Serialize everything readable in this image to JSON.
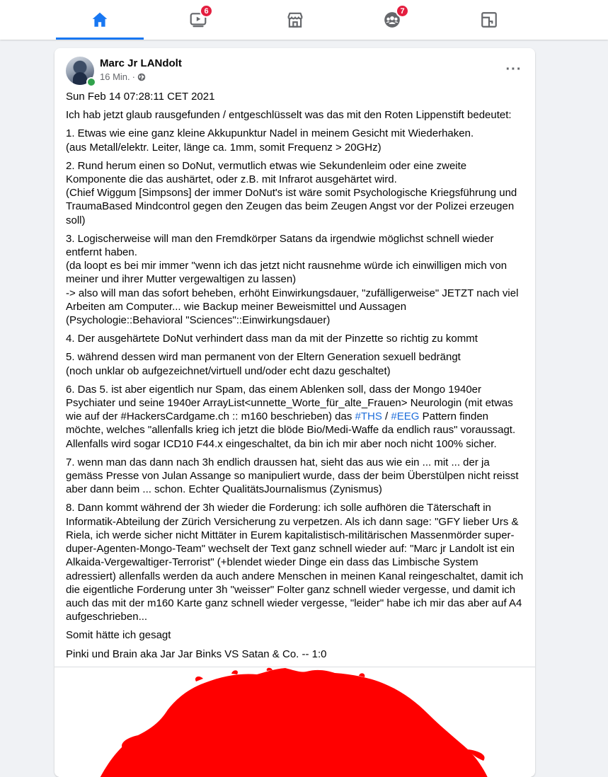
{
  "nav": {
    "tabs": [
      {
        "name": "home",
        "icon": "home-icon",
        "badge": ""
      },
      {
        "name": "watch",
        "icon": "video-icon",
        "badge": "6"
      },
      {
        "name": "marketplace",
        "icon": "store-icon",
        "badge": ""
      },
      {
        "name": "groups",
        "icon": "groups-icon",
        "badge": "7"
      },
      {
        "name": "gaming",
        "icon": "gaming-icon",
        "badge": ""
      }
    ],
    "accent": "#1877f2",
    "badge_color": "#e41e3f"
  },
  "post": {
    "author": "Marc Jr LANdolt",
    "time": "16 Min.",
    "separator": " · ",
    "privacy_icon": "globe-icon",
    "more_icon": "more-options-icon",
    "more_label": "···",
    "paragraphs": [
      "Sun Feb 14 07:28:11 CET 2021",
      "Ich hab jetzt glaub rausgefunden / entgeschlüsselt was das mit den Roten Lippenstift bedeutet:",
      "1. Etwas wie eine ganz kleine Akkupunktur Nadel in meinem Gesicht mit Wiederhaken.\n(aus Metall/elektr. Leiter, länge ca. 1mm, somit Frequenz > 20GHz)",
      "2. Rund herum einen so DoNut, vermutlich etwas wie Sekundenleim oder eine zweite Komponente die das aushärtet, oder z.B. mit Infrarot ausgehärtet wird.\n(Chief Wiggum [Simpsons] der immer DoNut's ist wäre somit Psychologische Kriegsführung und TraumaBased Mindcontrol gegen den Zeugen das beim Zeugen Angst vor der Polizei erzeugen soll)",
      "3. Logischerweise will man den Fremdkörper Satans da irgendwie möglichst schnell wieder entfernt haben.\n(da loopt es bei mir immer \"wenn ich das jetzt nicht rausnehme würde ich einwilligen mich von meiner und ihrer Mutter vergewaltigen zu lassen)\n-> also will man das sofort beheben, erhöht Einwirkungsdauer, \"zufälligerweise\" JETZT nach viel Arbeiten am Computer... wie Backup meiner Beweismittel und Aussagen (Psychologie::Behavioral \"Sciences\"::Einwirkungsdauer)",
      "4. Der ausgehärtete DoNut verhindert dass man da mit der Pinzette so richtig zu kommt",
      "5. während dessen wird man permanent von der Eltern Generation sexuell bedrängt\n(noch unklar ob aufgezeichnet/virtuell und/oder echt dazu geschaltet)",
      "7. wenn man das dann nach 3h endlich draussen hat, sieht das aus wie ein ... mit ... der ja gemäss Presse von Julan Assange so manipuliert wurde, dass der beim Überstülpen nicht reisst aber dann beim ... schon. Echter QualitätsJournalismus (Zynismus)",
      "8. Dann kommt während der 3h wieder die Forderung: ich solle aufhören die Täterschaft in Informatik-Abteilung der Zürich Versicherung zu verpetzen. Als ich dann sage: \"GFY lieber Urs & Riela, ich werde sicher nicht Mittäter in Eurem kapitalistisch-militärischen Massenmörder super-duper-Agenten-Mongo-Team\" wechselt der Text ganz schnell wieder auf: \"Marc jr Landolt ist ein Alkaida-Vergewaltiger-Terrorist\" (+blendet wieder Dinge ein dass das Limbische System adressiert) allenfalls werden da auch andere Menschen in meinen Kanal reingeschaltet, damit ich die eigentliche Forderung unter 3h \"weisser\" Folter ganz schnell wieder vergesse, und damit ich auch das mit der m160 Karte ganz schnell wieder vergesse, \"leider\" habe ich mir das aber auf A4 aufgeschrieben...",
      "Somit hätte ich gesagt",
      "Pinki und Brain aka Jar Jar Binks VS Satan & Co. -- 1:0"
    ],
    "p6": {
      "before": "6. Das 5. ist aber eigentlich nur Spam, das einem Ablenken soll, dass der Mongo 1940er Psychiater und seine 1940er ArrayList<unnette_Worte_für_alte_Frauen> Neurologin (mit etwas wie auf der #HackersCardgame.ch :: m160 beschrieben) das ",
      "tag1": "#THS",
      "slash": " / ",
      "tag2": "#EEG",
      "after": " Pattern finden möchte, welches \"allenfalls krieg ich jetzt die blöde Bio/Medi-Waffe da endlich raus\" voraussagt. Allenfalls wird sogar ICD10 F44.x eingeschaltet, da bin ich mir aber noch nicht 100% sicher."
    },
    "hashtag_color": "#216fdb",
    "image": {
      "subject": "red-lips-print",
      "color": "#ff0000"
    }
  }
}
